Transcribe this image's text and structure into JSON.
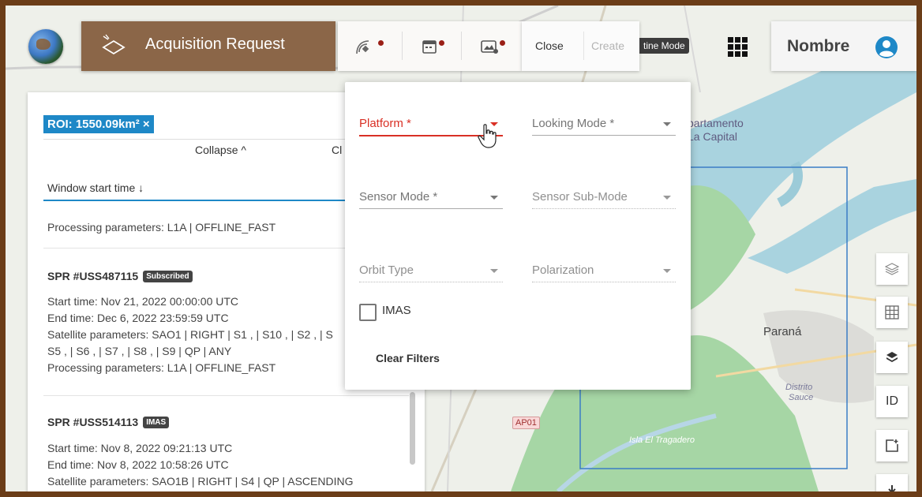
{
  "header": {
    "title": "Acquisition Request",
    "close_label": "Close",
    "create_label": "Create",
    "mode_tag": "tine Mode",
    "user_name": "Nombre"
  },
  "panel": {
    "roi_chip": "ROI: 1550.09km² ×",
    "collapse_label": "Collapse ^",
    "clipped_label": "Cl",
    "sort_label": "Window start time ↓",
    "top_processing": "Processing parameters: L1A | OFFLINE_FAST",
    "requests": [
      {
        "id": "SPR #USS487115",
        "badge": "Subscribed",
        "start": "Start time: Nov 21, 2022 00:00:00 UTC",
        "end": "End time: Dec 6, 2022 23:59:59 UTC",
        "satellite": "Satellite parameters: SAO1 | RIGHT | S1 , | S10 , | S2 , | S",
        "satellite2": "S5 , | S6 , | S7 , | S8 , | S9 | QP | ANY",
        "processing": "Processing parameters: L1A | OFFLINE_FAST"
      },
      {
        "id": "SPR #USS514113",
        "badge": "IMAS",
        "start": "Start time: Nov 8, 2022 09:21:13 UTC",
        "end": "End time: Nov 8, 2022 10:58:26 UTC",
        "satellite": "Satellite parameters: SAO1B | RIGHT | S4 | QP | ASCENDING"
      }
    ]
  },
  "filters": {
    "platform": "Platform *",
    "looking_mode": "Looking Mode *",
    "sensor_mode": "Sensor Mode *",
    "sensor_sub_mode": "Sensor Sub-Mode",
    "orbit_type": "Orbit Type",
    "polarization": "Polarization",
    "imas_label": "IMAS",
    "clear_label": "Clear Filters"
  },
  "map": {
    "labels": {
      "departamento": "partamento",
      "la_capital": "La Capital",
      "parana": "Paraná",
      "distrito": "Distrito",
      "sauce": "Sauce",
      "isla": "Isla El Tragadero",
      "route": "AP01"
    },
    "id_button": "ID"
  },
  "colors": {
    "accent": "#1e88c7",
    "brand": "#8b6648",
    "error": "#d93025",
    "frame": "#6b3d18"
  }
}
